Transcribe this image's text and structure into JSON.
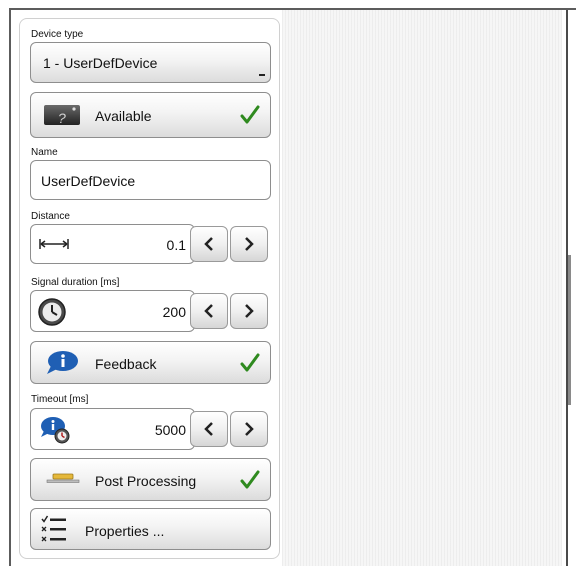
{
  "device_type": {
    "label": "Device type",
    "value": "1 - UserDefDevice"
  },
  "availability": {
    "label": "Available",
    "icon": "device-help-icon",
    "checked": true
  },
  "name": {
    "label": "Name",
    "value": "UserDefDevice"
  },
  "distance": {
    "label": "Distance",
    "value": "0.1",
    "icon": "distance-arrows-icon"
  },
  "signal_duration": {
    "label": "Signal duration [ms]",
    "value": "200",
    "icon": "clock-icon"
  },
  "feedback": {
    "label": "Feedback",
    "icon": "info-bubble-icon",
    "checked": true
  },
  "timeout": {
    "label": "Timeout  [ms]",
    "value": "5000",
    "icon": "info-clock-icon"
  },
  "post_processing": {
    "label": "Post Processing",
    "icon": "post-processing-icon",
    "checked": true
  },
  "properties": {
    "label": "Properties ...",
    "icon": "checklist-icon"
  },
  "colors": {
    "check_green": "#2f8a1f",
    "border": "#8e8e8e",
    "info_blue": "#1f5fb4"
  }
}
